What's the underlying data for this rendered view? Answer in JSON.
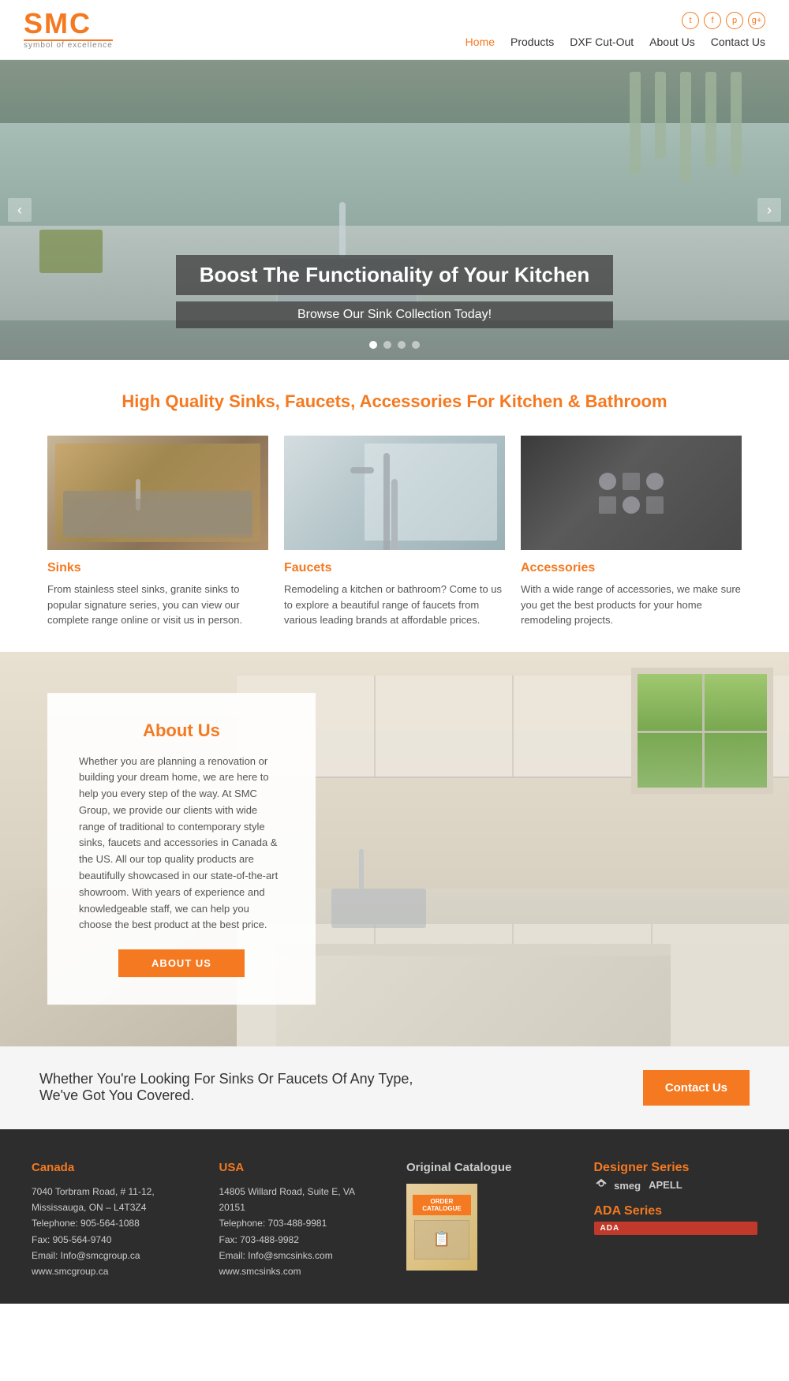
{
  "site": {
    "logo": {
      "main": "SMC",
      "sub": "symbol of excellence",
      "trademark": "™"
    },
    "social": [
      {
        "icon": "t",
        "name": "twitter"
      },
      {
        "icon": "f",
        "name": "facebook"
      },
      {
        "icon": "p",
        "name": "pinterest"
      },
      {
        "icon": "g+",
        "name": "googleplus"
      }
    ]
  },
  "nav": {
    "items": [
      {
        "label": "Home",
        "active": true
      },
      {
        "label": "Products",
        "active": false
      },
      {
        "label": "DXF Cut-Out",
        "active": false
      },
      {
        "label": "About Us",
        "active": false
      },
      {
        "label": "Contact Us",
        "active": false
      }
    ]
  },
  "hero": {
    "title": "Boost The Functionality of Your Kitchen",
    "subtitle": "Browse Our Sink Collection Today!",
    "dots": [
      true,
      false,
      false,
      false
    ],
    "arrow_left": "‹",
    "arrow_right": "›"
  },
  "products": {
    "tagline": "High Quality Sinks, Faucets, Accessories For Kitchen & Bathroom",
    "items": [
      {
        "title": "Sinks",
        "description": "From stainless steel sinks, granite sinks to popular signature series, you can view our complete range online or visit us in person."
      },
      {
        "title": "Faucets",
        "description": "Remodeling a kitchen or bathroom? Come to us to explore a beautiful range of faucets from various leading brands at affordable prices."
      },
      {
        "title": "Accessories",
        "description": "With a wide range of accessories, we make sure you get the best products for your home remodeling projects."
      }
    ]
  },
  "about": {
    "title": "About Us",
    "text": "Whether you are planning a renovation or building your dream home, we are here to help you every step of the way. At SMC Group, we provide our clients with wide range of traditional to contemporary style sinks, faucets and accessories in Canada & the US. All our top quality products are beautifully showcased in our state-of-the-art showroom. With years of experience and knowledgeable staff, we can help you choose the best product at the best price.",
    "button_label": "ABOUT US"
  },
  "cta": {
    "text": "Whether You're Looking For Sinks Or Faucets Of Any Type, We've Got You Covered.",
    "button_label": "Contact Us"
  },
  "footer": {
    "canada": {
      "title": "Canada",
      "address": "7040 Torbram Road, # 11-12, Mississauga, ON – L4T3Z4",
      "phone": "Telephone: 905-564-1088",
      "fax": "Fax: 905-564-9740",
      "email": "Email: Info@smcgroup.ca",
      "website": "www.smcgroup.ca"
    },
    "usa": {
      "title": "USA",
      "address": "14805 Willard Road, Suite E, VA 20151",
      "phone": "Telephone: 703-488-9981",
      "fax": "Fax: 703-488-9982",
      "email": "Email: Info@smcsinks.com",
      "website": "www.smcsinks.com"
    },
    "catalogue": {
      "title": "Original Catalogue",
      "label": "ORDER CATALOGUE"
    },
    "brands": {
      "designer": {
        "title": "Designer Series",
        "logos": [
          "smeg",
          "APELL"
        ]
      },
      "ada": {
        "title": "ADA Series",
        "badge": "ADA"
      }
    }
  }
}
